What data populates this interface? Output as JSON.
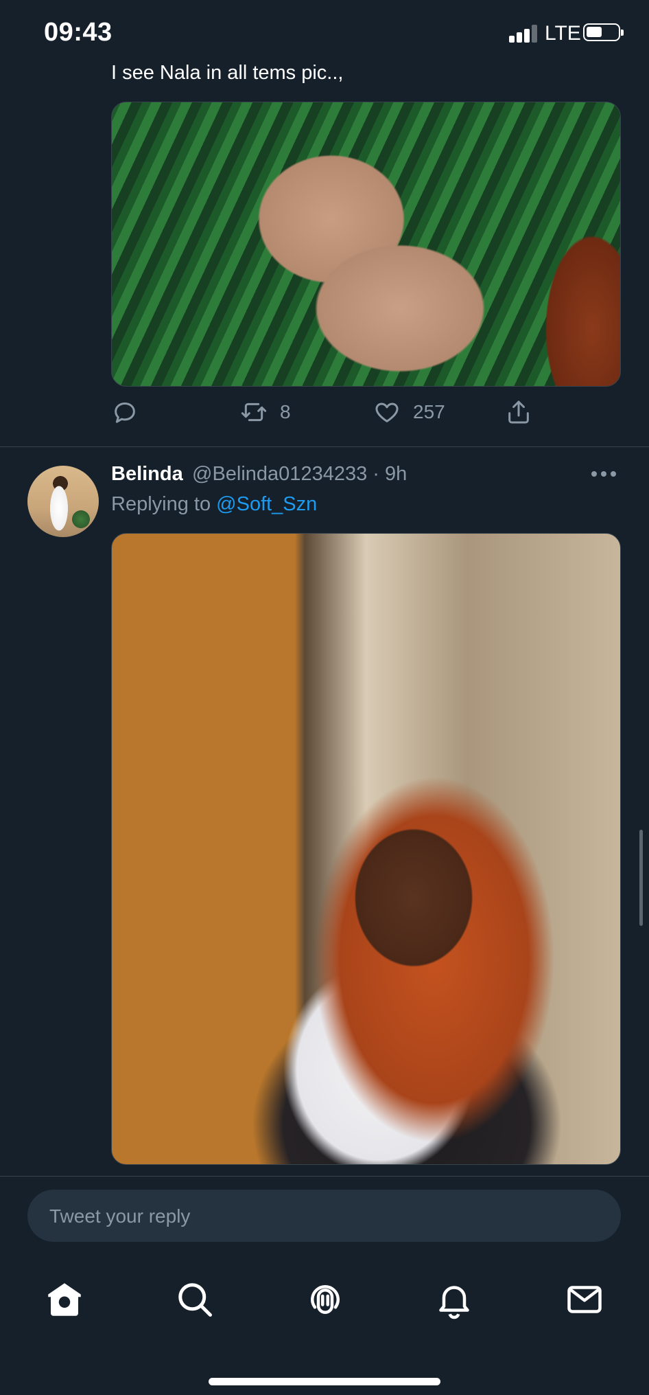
{
  "status_bar": {
    "time": "09:43",
    "network": "LTE"
  },
  "previous_tweet": {
    "text": "I see Nala in all tems pic..,",
    "retweets": "8",
    "likes": "257"
  },
  "tweet": {
    "name": "Belinda",
    "handle_time": "@Belinda01234233 · 9h",
    "replying_prefix": "Replying to ",
    "replying_to": "@Soft_Szn"
  },
  "reply": {
    "placeholder": "Tweet your reply"
  },
  "nav": {
    "items": [
      "home-icon",
      "search-icon",
      "spaces-icon",
      "notifications-icon",
      "messages-icon"
    ]
  },
  "colors": {
    "background": "#15202b",
    "accent": "#1d9bf0",
    "muted": "#8b98a5"
  }
}
